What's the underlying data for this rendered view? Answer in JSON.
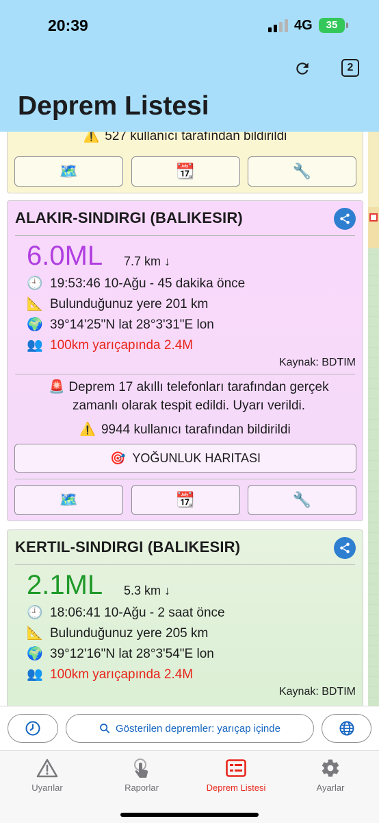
{
  "status_bar": {
    "time": "20:39",
    "network": "4G",
    "battery": "35"
  },
  "header": {
    "title": "Deprem Listesi",
    "tabs_count": "2"
  },
  "previous_card": {
    "reports_emoji": "⚠️",
    "reports_text": "527 kullanıcı tarafından bildirildi"
  },
  "action_buttons": {
    "map_emoji": "🗺️",
    "calendar_emoji": "📆",
    "tools_emoji": "🔧"
  },
  "quakes": [
    {
      "location": "ALAKIR-SINDIRGI (BALIKESIR)",
      "magnitude": "6.0ML",
      "magnitude_color": "#b03ee0",
      "depth": "7.7 km ↓",
      "time_emoji": "🕘",
      "time": "19:53:46 10-Ağu - 45 dakika önce",
      "distance_emoji": "📐",
      "distance": "Bulunduğunuz yere 201 km",
      "coords_emoji": "🌍",
      "coords": "39°14'25\"N lat 28°3'31\"E lon",
      "population_emoji": "👥",
      "population": "100km yarıçapında 2.4M",
      "source": "Kaynak: BDTIM",
      "alert_emoji": "🚨",
      "alert_text": "Deprem 17 akıllı telefonları tarafından gerçek zamanlı olarak tespit edildi. Uyarı verildi.",
      "reports_emoji": "⚠️",
      "reports_text": "9944 kullanıcı tarafından bildirildi",
      "intensity_emoji": "🎯",
      "intensity_label": "YOĞUNLUK HARITASI"
    },
    {
      "location": "KERTIL-SINDIRGI (BALIKESIR)",
      "magnitude": "2.1ML",
      "magnitude_color": "#1f9a2a",
      "depth": "5.3 km ↓",
      "time_emoji": "🕘",
      "time": "18:06:41 10-Ağu - 2 saat önce",
      "distance_emoji": "📐",
      "distance": "Bulunduğunuz yere 205 km",
      "coords_emoji": "🌍",
      "coords": "39°12'16\"N lat 28°3'54\"E lon",
      "population_emoji": "👥",
      "population": "100km yarıçapında 2.4M",
      "source": "Kaynak: BDTIM"
    }
  ],
  "filter_bar": {
    "filter_text": "Gösterilen depremler: yarıçap içinde"
  },
  "nav": {
    "items": [
      {
        "label": "Uyarılar"
      },
      {
        "label": "Raporlar"
      },
      {
        "label": "Deprem Listesi"
      },
      {
        "label": "Ayarlar"
      }
    ]
  },
  "colors": {
    "header_bg": "#a8defa",
    "accent": "#e8261b",
    "share_bg": "#2f7fd1",
    "link": "#1565c0"
  }
}
